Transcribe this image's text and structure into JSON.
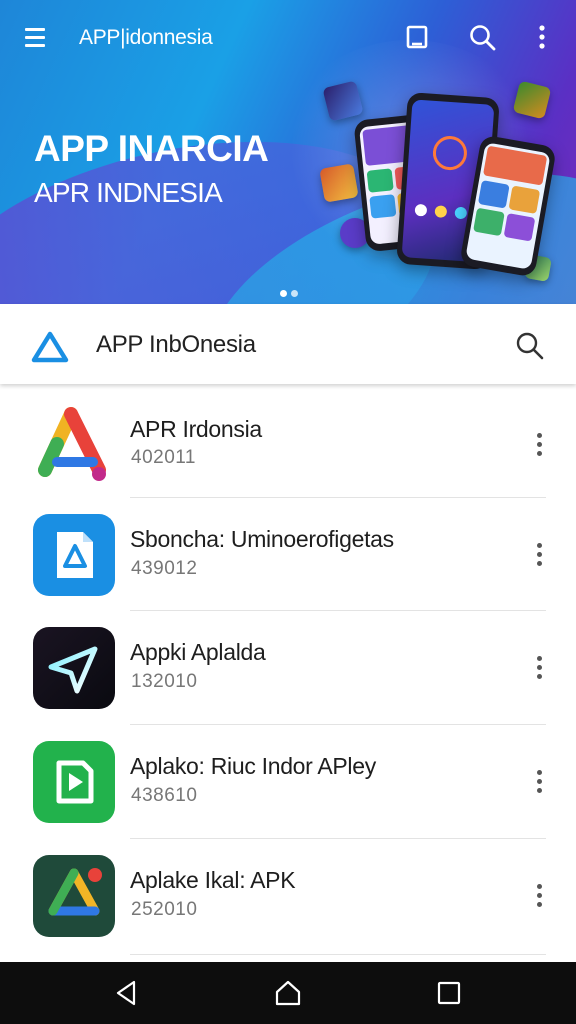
{
  "app_bar": {
    "brand": "APP|idonnesia",
    "icons": [
      "menu-icon",
      "bookmark-icon",
      "search-icon",
      "more-vert-icon"
    ]
  },
  "hero": {
    "title": "APP INARCIA",
    "subtitle": "APR INDNESIA",
    "carousel_pages": 2,
    "carousel_active": 1
  },
  "search_bar": {
    "title": "APP InbOnesia",
    "icons": [
      "triangle-logo-icon",
      "search-icon"
    ]
  },
  "apps": [
    {
      "name": "APR Irdonsia",
      "meta": "402011",
      "icon": "colorful-a-logo-icon"
    },
    {
      "name": "Sboncha: Uminoerofigetas",
      "meta": "439012",
      "icon": "blue-file-triangle-icon"
    },
    {
      "name": "Appki Aplalda",
      "meta": "132010",
      "icon": "paper-plane-icon"
    },
    {
      "name": "Aplako: Riuc Indor APley",
      "meta": "438610",
      "icon": "green-play-icon"
    },
    {
      "name": "Aplake Ikal: APK",
      "meta": "252010",
      "icon": "drive-triangle-icon"
    }
  ],
  "nav": {
    "icons": [
      "back-icon",
      "home-icon",
      "recents-icon"
    ]
  },
  "colors": {
    "hero_start": "#1e86d8",
    "hero_end": "#7a2bb8",
    "accent_blue": "#1a8fe3",
    "navbar": "#0d0d0d"
  }
}
